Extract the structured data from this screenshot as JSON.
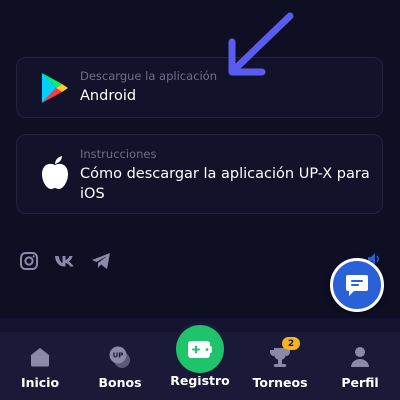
{
  "downloads": {
    "android": {
      "subtitle": "Descargue la aplicación",
      "title": "Android",
      "icon": "google-play-icon"
    },
    "ios": {
      "subtitle": "Instrucciones",
      "title": "Cómo descargar la aplicación UP-X para iOS",
      "icon": "apple-icon"
    }
  },
  "socials": [
    {
      "icon": "instagram-icon"
    },
    {
      "icon": "vk-icon"
    },
    {
      "icon": "telegram-icon"
    }
  ],
  "chat": {
    "icon": "chat-icon"
  },
  "nav": {
    "items": [
      {
        "label": "Inicio",
        "icon": "home-icon"
      },
      {
        "label": "Bonos",
        "icon": "bonus-icon"
      },
      {
        "label": "Registro",
        "icon": "wallet-add-icon"
      },
      {
        "label": "Torneos",
        "icon": "trophy-icon",
        "badge": "2"
      },
      {
        "label": "Perfil",
        "icon": "profile-icon"
      }
    ]
  },
  "colors": {
    "background": "#0f0f24",
    "accent_green": "#1fc46a",
    "chat_blue": "#2a60d8",
    "arrow_blue": "#5a5cf0",
    "badge_yellow": "#f4b322"
  }
}
